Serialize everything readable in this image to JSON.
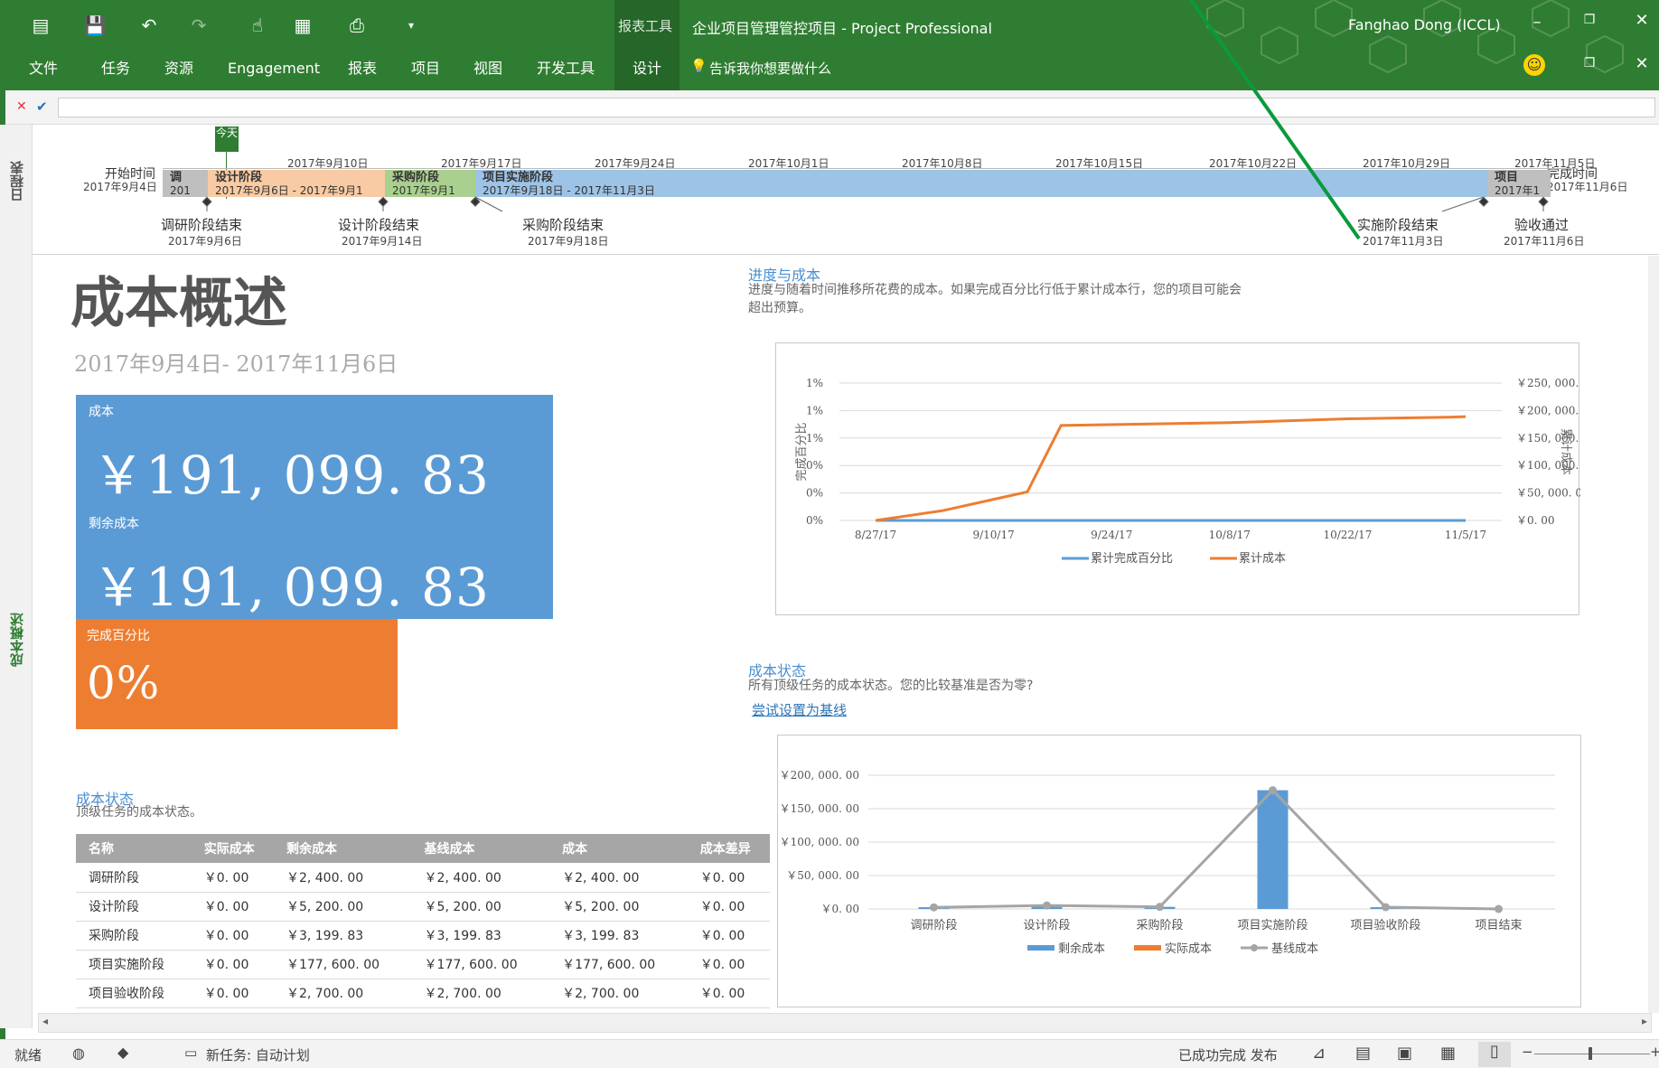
{
  "window": {
    "context_tab": "报表工具",
    "title": "企业项目管理管控项目  -  Project Professional",
    "user": "Fanghao Dong (ICCL)"
  },
  "ribbon": {
    "tabs": [
      "文件",
      "任务",
      "资源",
      "Engagement",
      "报表",
      "项目",
      "视图",
      "开发工具",
      "设计"
    ],
    "active_tab": "设计",
    "tell_me": "告诉我你想要做什么"
  },
  "formula_bar": {
    "value": ""
  },
  "side_labels": {
    "timeline": "日程表",
    "report": "成本概述"
  },
  "timeline": {
    "today_label": "今天",
    "start_label": "开始时间",
    "start_date": "2017年9月4日",
    "end_label": "完成时间",
    "end_date": "2017年11月6日",
    "dates": [
      "2017年9月10日",
      "2017年9月17日",
      "2017年9月24日",
      "2017年10月1日",
      "2017年10月8日",
      "2017年10月15日",
      "2017年10月22日",
      "2017年10月29日",
      "2017年11月5日"
    ],
    "segments": [
      {
        "name": "调",
        "dates": "201",
        "color": "#bfbfbf"
      },
      {
        "name": "设计阶段",
        "dates": "2017年9月6日  -  2017年9月1",
        "color": "#f8cba4"
      },
      {
        "name": "采购阶段",
        "dates": "2017年9月1",
        "color": "#a9d08e"
      },
      {
        "name": "项目实施阶段",
        "dates": "2017年9月18日  -  2017年11月3日",
        "color": "#9dc3e6"
      },
      {
        "name": "项目",
        "dates": "2017年1",
        "color": "#bfbfbf"
      }
    ],
    "milestones": [
      {
        "name": "调研阶段结束",
        "date": "2017年9月6日"
      },
      {
        "name": "设计阶段结束",
        "date": "2017年9月14日"
      },
      {
        "name": "采购阶段结束",
        "date": "2017年9月18日"
      },
      {
        "name": "实施阶段结束",
        "date": "2017年11月3日"
      },
      {
        "name": "验收通过",
        "date": "2017年11月6日"
      }
    ]
  },
  "report": {
    "title": "成本概述",
    "date_range": "2017年9月4日- 2017年11月6日",
    "cards": {
      "cost_label": "成本",
      "cost_value": "￥191, 099. 83",
      "remaining_label": "剩余成本",
      "remaining_value": "￥191, 099. 83",
      "pct_label": "完成百分比",
      "pct_value": "0%"
    },
    "progress_section": {
      "title": "进度与成本",
      "desc_line1": "进度与随着时间推移所花费的成本。如果完成百分比行低于累计成本行，您的项目可能会",
      "desc_line2": "超出预算。"
    },
    "status_section_right": {
      "title": "成本状态",
      "desc": "所有顶级任务的成本状态。您的比较基准是否为零?",
      "link": "尝试设置为基线"
    },
    "status_section_left": {
      "title": "成本状态",
      "desc": "顶级任务的成本状态。"
    },
    "table": {
      "headers": [
        "名称",
        "实际成本",
        "剩余成本",
        "基线成本",
        "成本",
        "成本差异"
      ],
      "rows": [
        [
          "调研阶段",
          "￥0. 00",
          "￥2, 400. 00",
          "￥2, 400. 00",
          "￥2, 400. 00",
          "￥0. 00"
        ],
        [
          "设计阶段",
          "￥0. 00",
          "￥5, 200. 00",
          "￥5, 200. 00",
          "￥5, 200. 00",
          "￥0. 00"
        ],
        [
          "采购阶段",
          "￥0. 00",
          "￥3, 199. 83",
          "￥3, 199. 83",
          "￥3, 199. 83",
          "￥0. 00"
        ],
        [
          "项目实施阶段",
          "￥0. 00",
          "￥177, 600. 00",
          "￥177, 600. 00",
          "￥177, 600. 00",
          "￥0. 00"
        ],
        [
          "项目验收阶段",
          "￥0. 00",
          "￥2, 700. 00",
          "￥2, 700. 00",
          "￥2, 700. 00",
          "￥0. 00"
        ]
      ]
    }
  },
  "chart_data": [
    {
      "type": "line",
      "x": [
        "8/27/17",
        "9/10/17",
        "9/24/17",
        "10/8/17",
        "10/22/17",
        "11/5/17"
      ],
      "ylabel": "完成百分比",
      "y2label": "累计成本",
      "y_ticks": [
        "1%",
        "1%",
        "1%",
        "0%",
        "0%",
        "0%"
      ],
      "y2_ticks": [
        "￥250, 000. 00",
        "￥200, 000. 00",
        "￥150, 000. 00",
        "￥100, 000. 00",
        "￥50, 000. 00",
        "￥0. 00"
      ],
      "ylim2": [
        0,
        250000
      ],
      "series": [
        {
          "name": "累计完成百分比",
          "axis": "left",
          "color": "#5b9bd5",
          "points": [
            [
              "8/27/17",
              0
            ],
            [
              "11/5/17",
              0
            ]
          ]
        },
        {
          "name": "累计成本",
          "axis": "right",
          "color": "#ed7d31",
          "points": [
            [
              "8/27/17",
              0
            ],
            [
              "9/4/17",
              18000
            ],
            [
              "9/14/17",
              52000
            ],
            [
              "9/18/17",
              173000
            ],
            [
              "10/8/17",
              178000
            ],
            [
              "10/22/17",
              185000
            ],
            [
              "11/3/17",
              188000
            ],
            [
              "11/5/17",
              189000
            ]
          ]
        }
      ]
    },
    {
      "type": "bar",
      "categories": [
        "调研阶段",
        "设计阶段",
        "采购阶段",
        "项目实施阶段",
        "项目验收阶段",
        "项目结束"
      ],
      "y_ticks": [
        "￥200, 000. 00",
        "￥150, 000. 00",
        "￥100, 000. 00",
        "￥50, 000. 00",
        "￥0. 00"
      ],
      "ylim": [
        0,
        200000
      ],
      "series": [
        {
          "name": "剩余成本",
          "kind": "bar",
          "color": "#5b9bd5",
          "values": [
            2400,
            5200,
            3199.83,
            177600,
            2700,
            0
          ]
        },
        {
          "name": "实际成本",
          "kind": "bar",
          "color": "#ed7d31",
          "values": [
            0,
            0,
            0,
            0,
            0,
            0
          ]
        },
        {
          "name": "基线成本",
          "kind": "line",
          "color": "#a5a5a5",
          "values": [
            2400,
            5200,
            3199.83,
            177600,
            2700,
            0
          ]
        }
      ]
    }
  ],
  "statusbar": {
    "ready": "就绪",
    "new_task": "新任务: 自动计划",
    "publish": "已成功完成 发布"
  }
}
